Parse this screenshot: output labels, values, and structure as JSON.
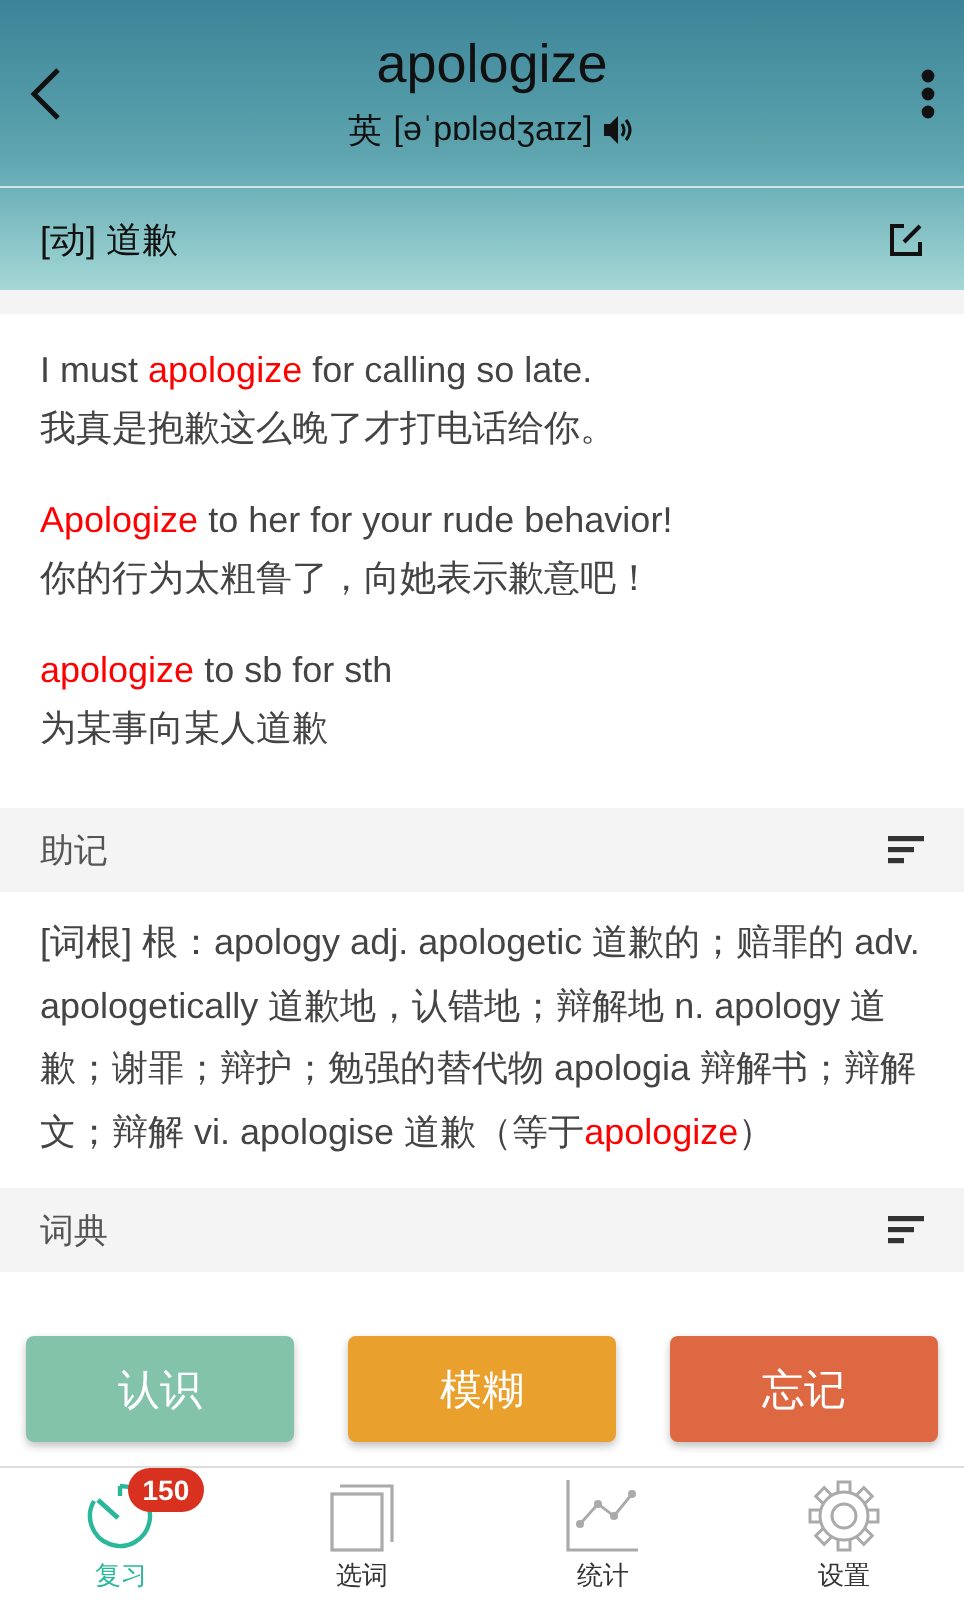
{
  "header": {
    "word": "apologize",
    "accent": "英",
    "phonetic": "[əˈpɒlədʒaɪz]",
    "definition": "[动] 道歉"
  },
  "examples": [
    {
      "en": "I must **apologize** for calling so late.",
      "zh": "我真是抱歉这么晚了才打电话给你。"
    },
    {
      "en": "**Apologize** to her for your rude behavior!",
      "zh": "你的行为太粗鲁了，向她表示歉意吧！"
    },
    {
      "en": "**apologize** to sb for sth",
      "zh": "为某事向某人道歉"
    }
  ],
  "sections": [
    {
      "title": "助记",
      "body": "[词根] 根：apology adj. apologetic 道歉的；赔罪的 adv. apologetically 道歉地，认错地；辩解地 n. apology 道歉；谢罪；辩护；勉强的替代物 apologia 辩解书；辩解文；辩解 vi. apologise 道歉（等于**apologize**）"
    },
    {
      "title": "词典"
    }
  ],
  "actions": [
    {
      "label": "认识",
      "color": "#82c3aa"
    },
    {
      "label": "模糊",
      "color": "#e9a02c"
    },
    {
      "label": "忘记",
      "color": "#dd6841"
    }
  ],
  "nav": [
    {
      "label": "复习",
      "kind": "timer",
      "selected": true,
      "badge": "150"
    },
    {
      "label": "选词",
      "kind": "cards",
      "selected": false
    },
    {
      "label": "统计",
      "kind": "chart",
      "selected": false
    },
    {
      "label": "设置",
      "kind": "gear",
      "selected": false
    }
  ]
}
